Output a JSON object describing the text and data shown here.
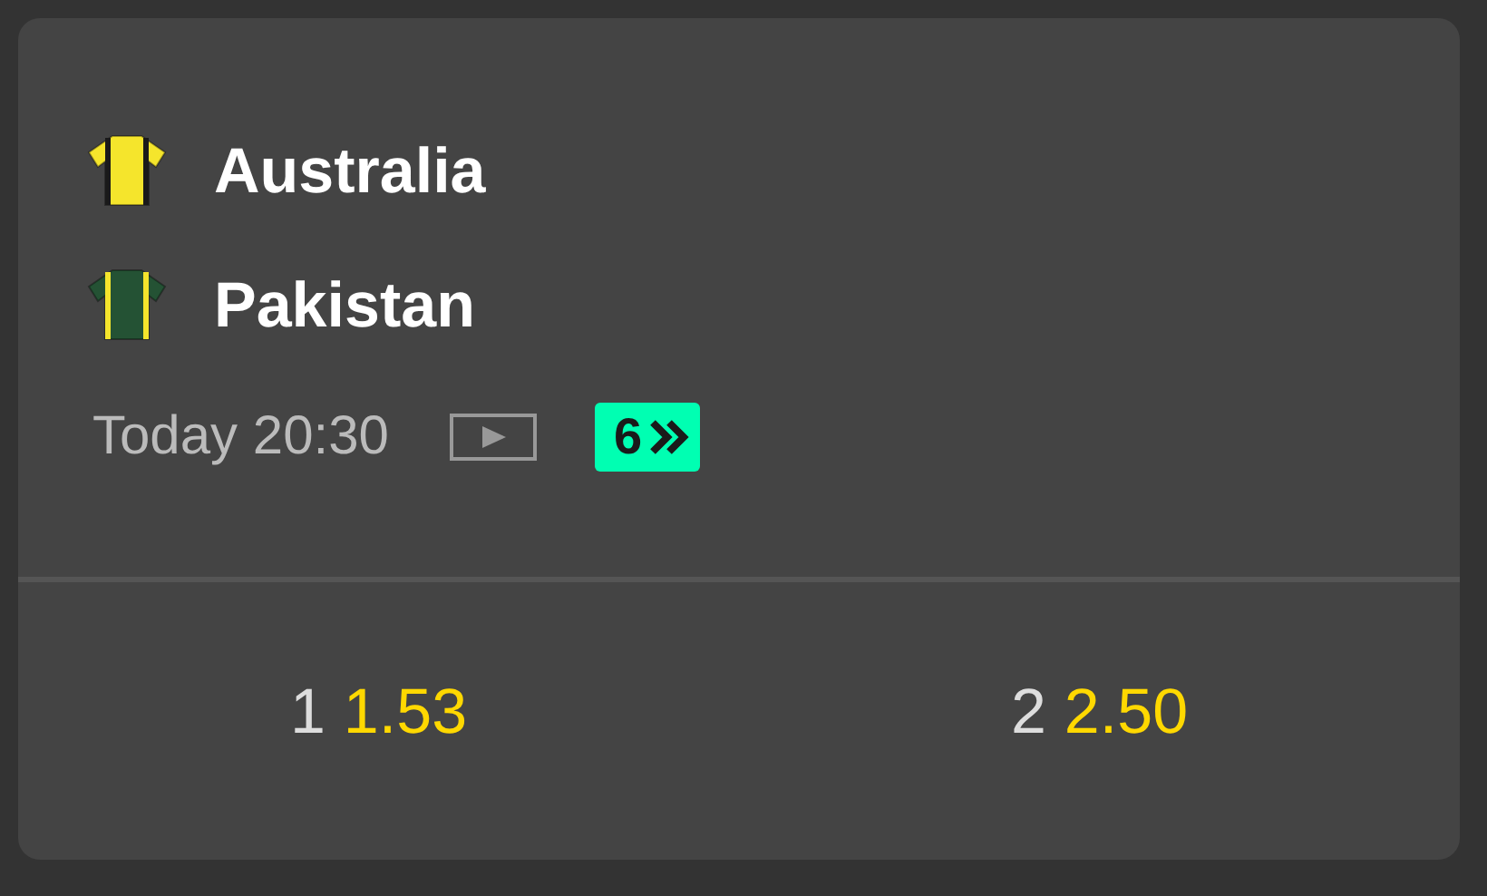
{
  "teams": [
    {
      "name": "Australia",
      "color": "#f5e52c",
      "kind": "dark-stripes"
    },
    {
      "name": "Pakistan",
      "color": "#245234",
      "kind": "light-stripes"
    }
  ],
  "start_time": "Today 20:30",
  "live_stream": true,
  "markets_count": "6",
  "odds": [
    {
      "label": "1",
      "price": "1.53"
    },
    {
      "label": "2",
      "price": "2.50"
    }
  ]
}
